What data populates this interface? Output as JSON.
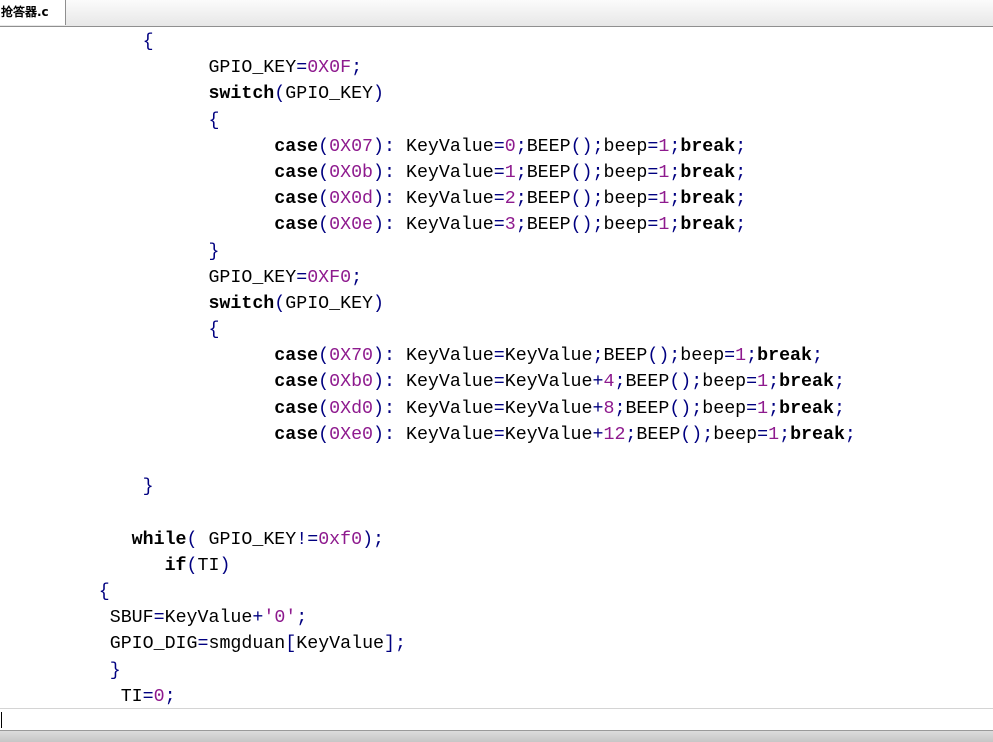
{
  "tab": {
    "label": "抢答器.c"
  },
  "code": {
    "lines": [
      {
        "indent": 13,
        "tokens": [
          [
            "{",
            "op"
          ]
        ]
      },
      {
        "indent": 19,
        "tokens": [
          [
            "GPIO_KEY",
            "id"
          ],
          [
            "=",
            "op"
          ],
          [
            "0X0F",
            "num"
          ],
          [
            ";",
            "op"
          ]
        ]
      },
      {
        "indent": 19,
        "tokens": [
          [
            "switch",
            "kw"
          ],
          [
            "(",
            "op"
          ],
          [
            "GPIO_KEY",
            "id"
          ],
          [
            ")",
            "op"
          ]
        ]
      },
      {
        "indent": 19,
        "tokens": [
          [
            "{",
            "op"
          ]
        ]
      },
      {
        "indent": 25,
        "tokens": [
          [
            "case",
            "kw"
          ],
          [
            "(",
            "op"
          ],
          [
            "0X07",
            "num"
          ],
          ")",
          [
            "op"
          ]
        ]
      },
      {
        "indent": 25,
        "tokens": [
          [
            "case",
            "kw"
          ],
          [
            "(",
            "op"
          ],
          [
            "0X0b",
            "num"
          ],
          [
            ")",
            "op"
          ]
        ]
      },
      {
        "indent": 25,
        "tokens": [
          [
            "case",
            "kw"
          ],
          [
            "(",
            "op"
          ],
          [
            "0X0d",
            "num"
          ],
          [
            ")",
            "op"
          ]
        ]
      },
      {
        "indent": 25,
        "tokens": [
          [
            "case",
            "kw"
          ],
          [
            "(",
            "op"
          ],
          [
            "0X0e",
            "num"
          ],
          [
            ")",
            "op"
          ]
        ]
      },
      {
        "indent": 19,
        "tokens": [
          [
            "}",
            "op"
          ]
        ]
      },
      {
        "indent": 19,
        "tokens": [
          [
            "GPIO_KEY",
            "id"
          ],
          [
            "=",
            "op"
          ],
          [
            "0XF0",
            "num"
          ],
          [
            ";",
            "op"
          ]
        ]
      },
      {
        "indent": 19,
        "tokens": [
          [
            "switch",
            "kw"
          ],
          [
            "(",
            "op"
          ],
          [
            "GPIO_KEY",
            "id"
          ],
          [
            ")",
            "op"
          ]
        ]
      },
      {
        "indent": 19,
        "tokens": [
          [
            "{",
            "op"
          ]
        ]
      },
      {
        "indent": 25,
        "tokens": [
          [
            "case",
            "kw"
          ],
          [
            "(",
            "op"
          ],
          [
            "0X70",
            "num"
          ],
          [
            ")",
            "op"
          ]
        ]
      },
      {
        "indent": 25,
        "tokens": [
          [
            "case",
            "kw"
          ],
          [
            "(",
            "op"
          ],
          [
            "0Xb0",
            "num"
          ],
          [
            ")",
            "op"
          ]
        ]
      },
      {
        "indent": 25,
        "tokens": [
          [
            "case",
            "kw"
          ],
          [
            "(",
            "op"
          ],
          [
            "0Xd0",
            "num"
          ],
          [
            ")",
            "op"
          ]
        ]
      },
      {
        "indent": 25,
        "tokens": [
          [
            "case",
            "kw"
          ],
          [
            "(",
            "op"
          ],
          [
            "0Xe0",
            "num"
          ],
          [
            ")",
            "op"
          ]
        ]
      },
      {
        "indent": 0,
        "tokens": []
      },
      {
        "indent": 13,
        "tokens": [
          [
            "}",
            "op"
          ]
        ]
      },
      {
        "indent": 0,
        "tokens": []
      },
      {
        "indent": 12,
        "tokens": [
          [
            "while",
            "kw"
          ],
          [
            "( ",
            "op"
          ],
          [
            "GPIO_KEY",
            "id"
          ],
          [
            "!=",
            "op"
          ],
          [
            "0xf0",
            "num"
          ],
          [
            ");",
            "op"
          ]
        ]
      },
      {
        "indent": 15,
        "tokens": [
          [
            "if",
            "kw"
          ],
          [
            "(",
            "op"
          ],
          [
            "TI",
            "id"
          ],
          [
            ")",
            "op"
          ]
        ]
      },
      {
        "indent": 9,
        "tokens": [
          [
            "{",
            "op"
          ]
        ]
      },
      {
        "indent": 10,
        "tokens": [
          [
            "SBUF",
            "id"
          ],
          [
            "=",
            "op"
          ],
          [
            "KeyValue",
            "id"
          ],
          [
            "+",
            "op"
          ],
          [
            "'0'",
            "str"
          ],
          [
            ";",
            "op"
          ]
        ]
      },
      {
        "indent": 10,
        "tokens": [
          [
            "GPIO_DIG",
            "id"
          ],
          [
            "=",
            "op"
          ],
          [
            "smgduan",
            "id"
          ],
          [
            "[",
            "op"
          ],
          [
            "KeyValue",
            "id"
          ],
          [
            "];",
            "op"
          ]
        ]
      },
      {
        "indent": 10,
        "tokens": [
          [
            "}",
            "op"
          ]
        ]
      },
      {
        "indent": 11,
        "tokens": [
          [
            "TI",
            "id"
          ],
          [
            "=",
            "op"
          ],
          [
            "0",
            "num"
          ],
          [
            ";",
            "op"
          ]
        ]
      }
    ]
  }
}
